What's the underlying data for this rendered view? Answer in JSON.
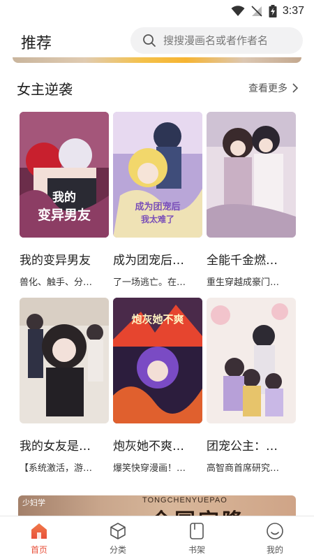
{
  "status_bar": {
    "time": "3:37"
  },
  "header": {
    "title": "推荐",
    "search_placeholder": "搜搜漫画名或者作者名"
  },
  "section": {
    "title": "女主逆袭",
    "see_more": "查看更多"
  },
  "comics": [
    {
      "title": "我的变异男友",
      "desc": "兽化、触手、分…",
      "cover_text": "我的变异男友"
    },
    {
      "title": "成为团宠后…",
      "desc": "了一场逃亡。在…",
      "cover_text": "成为团宠后 我太难了"
    },
    {
      "title": "全能千金燃…",
      "desc": "重生穿越成豪门…",
      "cover_text": ""
    },
    {
      "title": "我的女友是…",
      "desc": "【系统激活，游…",
      "cover_text": ""
    },
    {
      "title": "炮灰她不爽…",
      "desc": "爆笑快穿漫画！…",
      "cover_text": "炮灰她不爽"
    },
    {
      "title": "团宠公主：…",
      "desc": "高智商首席研究…",
      "cover_text": ""
    }
  ],
  "bottom_banner": {
    "tag": "少妇学",
    "pinyin": "TONGCHENYUEPAO",
    "headline": "全国宫隆"
  },
  "nav": {
    "items": [
      {
        "label": "首页",
        "icon": "home-icon",
        "active": true
      },
      {
        "label": "分类",
        "icon": "cube-icon",
        "active": false
      },
      {
        "label": "书架",
        "icon": "bookshelf-icon",
        "active": false
      },
      {
        "label": "我的",
        "icon": "profile-icon",
        "active": false
      }
    ]
  },
  "colors": {
    "accent": "#e8503a",
    "text": "#1f1f1f",
    "search_bg": "#f2f2f3"
  }
}
